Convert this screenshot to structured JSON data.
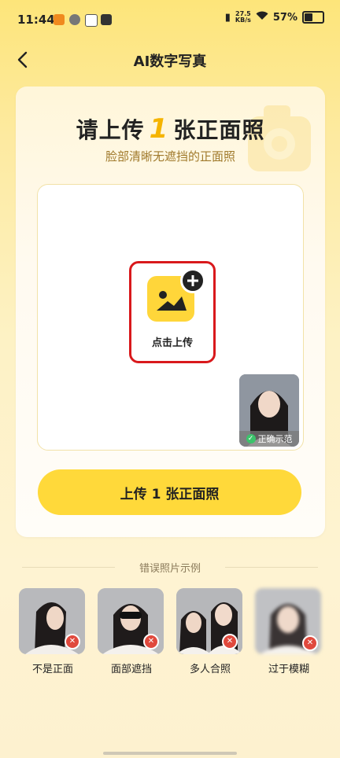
{
  "status_bar": {
    "time": "11:44",
    "net_speed_top": "27.5",
    "net_speed_bottom": "KB/s",
    "battery": "57%"
  },
  "header": {
    "title": "AI数字写真"
  },
  "card": {
    "headline_pre": "请上传",
    "headline_num": "1",
    "headline_post": "张正面照",
    "subtitle": "脸部清晰无遮挡的正面照",
    "upload_label": "点击上传",
    "sample_tag": "正确示范",
    "cta_label": "上传 1 张正面照"
  },
  "wrong_examples": {
    "title": "错误照片示例",
    "items": [
      {
        "label": "不是正面"
      },
      {
        "label": "面部遮挡"
      },
      {
        "label": "多人合照"
      },
      {
        "label": "过于模糊"
      }
    ]
  },
  "colors": {
    "accent": "#ffd93a",
    "highlight_border": "#d9191c",
    "error": "#e0493d",
    "ok": "#3cc36b"
  }
}
